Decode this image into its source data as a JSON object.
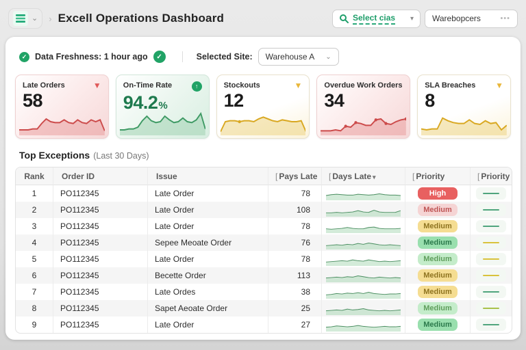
{
  "header": {
    "title": "Excell Operations Dashboard",
    "menu_chevron": "⌄",
    "breadcrumb_separator": "›",
    "search_box": {
      "label": "Select cias",
      "chevron": "▾"
    },
    "value_box": {
      "value": "Warebopcers",
      "more": "•••"
    }
  },
  "status_bar": {
    "freshness_label": "Data Freshness: 1 hour ago",
    "check_glyph": "✓",
    "site_label": "Selected Site:",
    "site_value": "Warehouse A",
    "chevron": "⌄"
  },
  "kpis": [
    {
      "title": "Late Orders",
      "value": "58",
      "suffix": "",
      "icon": "triangle-down",
      "variant": "red",
      "spark": {
        "points": [
          4,
          4,
          4,
          5,
          5,
          11,
          16,
          13,
          12,
          12,
          15,
          12,
          11,
          15,
          12,
          11,
          15,
          13,
          15,
          3
        ],
        "line": "#cc4b4b",
        "fill": "#e89a9a"
      }
    },
    {
      "title": "On-Time Rate",
      "value": "94.2",
      "suffix": "%",
      "icon": "circle-up",
      "variant": "green",
      "spark": {
        "points": [
          4,
          4,
          5,
          5,
          7,
          14,
          19,
          14,
          12,
          13,
          19,
          15,
          12,
          13,
          17,
          13,
          12,
          15,
          22,
          5
        ],
        "line": "#3e9a64",
        "fill": "#9ccfad"
      }
    },
    {
      "title": "Stockouts",
      "value": "12",
      "suffix": "",
      "icon": "triangle-down",
      "variant": "yellow",
      "spark": {
        "points": [
          2,
          13,
          14,
          14,
          13,
          14,
          14,
          13,
          16,
          18,
          16,
          14,
          13,
          15,
          14,
          13,
          13,
          14,
          2
        ],
        "dots": [
          4
        ],
        "line": "#d9a821",
        "fill": "#ecd27e"
      }
    },
    {
      "title": "Overdue Work Orders",
      "value": "34",
      "suffix": "",
      "icon": "none",
      "variant": "red",
      "spark": {
        "points": [
          3,
          3,
          3,
          4,
          3,
          8,
          7,
          12,
          11,
          9,
          9,
          15,
          16,
          11,
          10,
          13,
          15,
          16
        ],
        "dots": [
          5,
          7,
          11,
          13,
          17
        ],
        "line": "#cc4b4b",
        "fill": "#e89a9a"
      }
    },
    {
      "title": "SLA Breaches",
      "value": "8",
      "suffix": "",
      "icon": "triangle-down",
      "variant": "yellow",
      "spark": {
        "points": [
          5,
          4,
          5,
          5,
          17,
          14,
          12,
          11,
          11,
          15,
          11,
          10,
          14,
          11,
          12,
          4,
          9
        ],
        "line": "#d9a821",
        "fill": "#ecd27e"
      }
    }
  ],
  "exceptions": {
    "title": "Top Exceptions",
    "subtitle": "(Last 30 Days)",
    "columns": [
      {
        "prefix": "",
        "label": "Rank",
        "sort": ""
      },
      {
        "prefix": "",
        "label": "Order ID",
        "sort": ""
      },
      {
        "prefix": "",
        "label": "Issue",
        "sort": ""
      },
      {
        "prefix": "[",
        "label": "Pays Late",
        "sort": ""
      },
      {
        "prefix": "[",
        "label": "Days Late",
        "sort": "▾"
      },
      {
        "prefix": "[",
        "label": "Priority",
        "sort": ""
      },
      {
        "prefix": "[",
        "label": "Priority",
        "sort": ""
      }
    ],
    "rows": [
      {
        "rank": "1",
        "order_id": "PO112345",
        "issue": "Late Order",
        "days_late": "78",
        "priority": "High",
        "priority_variant": "high",
        "trend": "green",
        "spark": {
          "points": [
            9,
            11,
            12,
            11,
            10,
            10,
            12,
            11,
            10,
            11,
            13,
            11,
            10,
            10,
            9
          ]
        }
      },
      {
        "rank": "2",
        "order_id": "PO112345",
        "issue": "Late Order",
        "days_late": "108",
        "priority": "Medium",
        "priority_variant": "med-pink",
        "trend": "green",
        "spark": {
          "points": [
            7,
            7,
            8,
            7,
            8,
            9,
            12,
            9,
            8,
            13,
            9,
            8,
            8,
            8,
            12
          ]
        }
      },
      {
        "rank": "3",
        "order_id": "PO112345",
        "issue": "Late Order",
        "days_late": "78",
        "priority": "Medium",
        "priority_variant": "med-yellow",
        "trend": "green",
        "spark": {
          "points": [
            8,
            7,
            8,
            9,
            11,
            9,
            8,
            8,
            11,
            12,
            9,
            8,
            8,
            8,
            9
          ]
        }
      },
      {
        "rank": "4",
        "order_id": "PO112345",
        "issue": "Sepee Meoate Order",
        "days_late": "76",
        "priority": "Medium",
        "priority_variant": "med-green",
        "trend": "yellow",
        "spark": {
          "points": [
            7,
            8,
            9,
            8,
            10,
            9,
            12,
            10,
            13,
            11,
            9,
            8,
            9,
            8,
            7
          ]
        }
      },
      {
        "rank": "5",
        "order_id": "PO112345",
        "issue": "Late Order",
        "days_late": "78",
        "priority": "Medium",
        "priority_variant": "med-lightgreen",
        "trend": "yellow",
        "spark": {
          "points": [
            7,
            8,
            9,
            10,
            9,
            12,
            10,
            9,
            12,
            10,
            8,
            9,
            8,
            9,
            10
          ]
        }
      },
      {
        "rank": "6",
        "order_id": "PO112345",
        "issue": "Becette Order",
        "days_late": "113",
        "priority": "Medium",
        "priority_variant": "med-yellow",
        "trend": "yellow",
        "spark": {
          "points": [
            8,
            9,
            10,
            9,
            11,
            10,
            13,
            11,
            9,
            8,
            10,
            9,
            8,
            9,
            8
          ]
        }
      },
      {
        "rank": "7",
        "order_id": "PO112345",
        "issue": "Late Ordes",
        "days_late": "38",
        "priority": "Medium",
        "priority_variant": "med-yellow",
        "trend": "green",
        "spark": {
          "points": [
            7,
            8,
            10,
            9,
            11,
            10,
            12,
            10,
            13,
            10,
            9,
            8,
            9,
            9,
            10
          ]
        }
      },
      {
        "rank": "8",
        "order_id": "PO112345",
        "issue": "Sapet Aeoate Order",
        "days_late": "25",
        "priority": "Medium",
        "priority_variant": "med-lightgreen",
        "trend": "yellowgreen",
        "spark": {
          "points": [
            8,
            9,
            10,
            9,
            12,
            10,
            11,
            13,
            10,
            9,
            8,
            9,
            8,
            9,
            10
          ]
        }
      },
      {
        "rank": "9",
        "order_id": "PO112345",
        "issue": "Late Order",
        "days_late": "27",
        "priority": "Medium",
        "priority_variant": "med-green",
        "trend": "green",
        "spark": {
          "points": [
            8,
            9,
            11,
            10,
            9,
            10,
            12,
            10,
            9,
            8,
            9,
            10,
            9,
            9,
            10
          ]
        }
      }
    ]
  },
  "colors": {
    "accent_green": "#1e9e6a",
    "table_spark_line": "#4c8f62",
    "table_spark_fill": "#a8d8b4"
  }
}
